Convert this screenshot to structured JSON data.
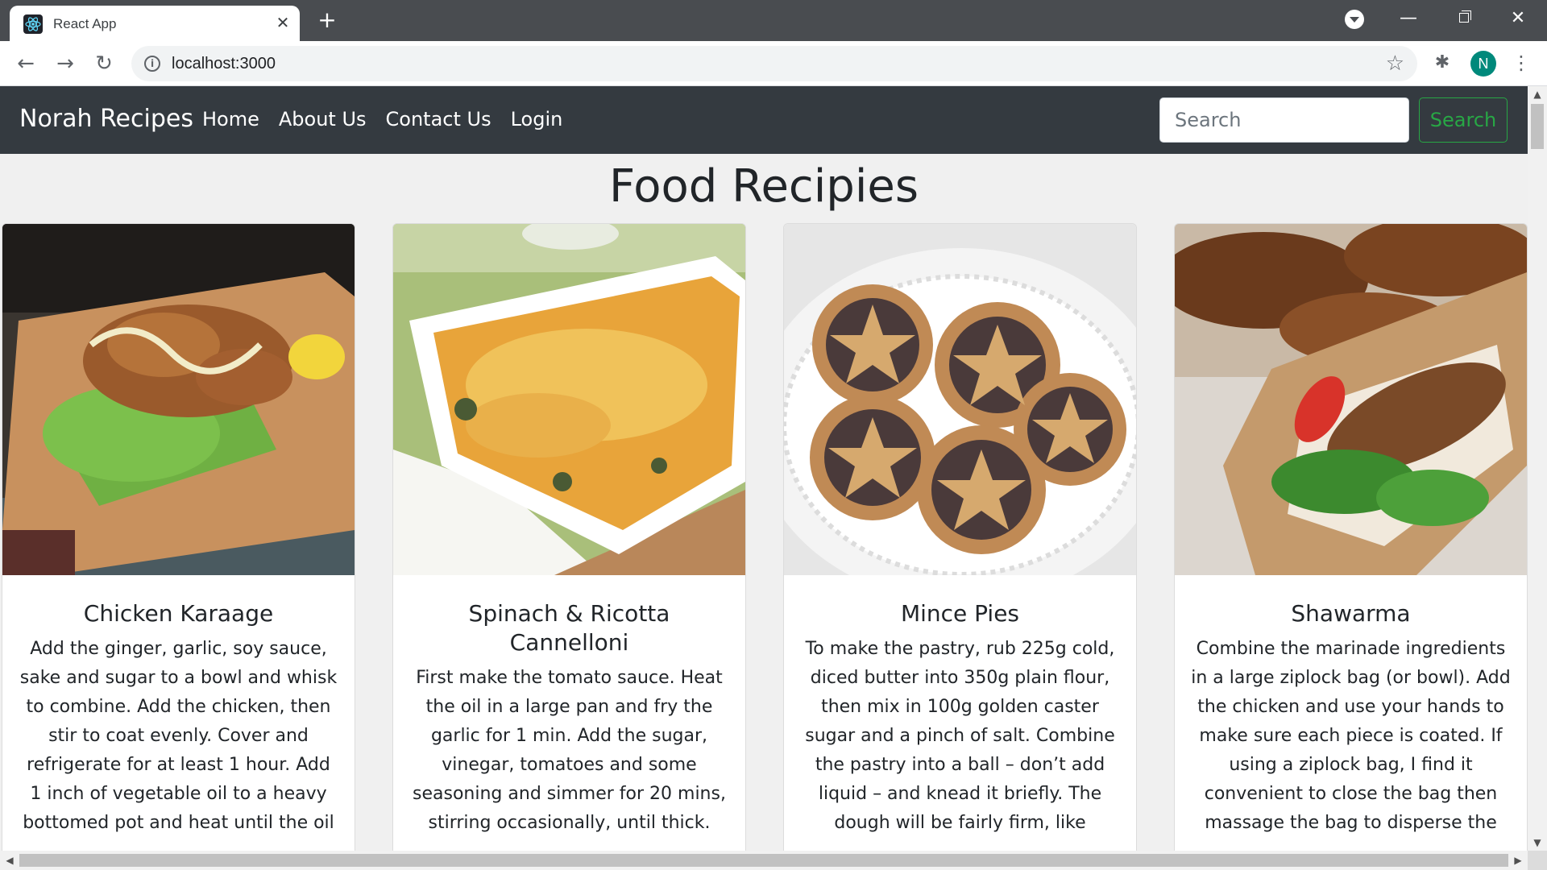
{
  "browser": {
    "tab_title": "React App",
    "tab_close": "✕",
    "new_tab": "+",
    "url": "localhost:3000",
    "back": "←",
    "forward": "→",
    "reload": "↻",
    "info": "i",
    "star": "☆",
    "extensions": "✱",
    "profile_initial": "N",
    "menu": "⋮",
    "minimize": "—",
    "close": "✕"
  },
  "navbar": {
    "brand": "Norah Recipes",
    "links": [
      "Home",
      "About Us",
      "Contact Us",
      "Login"
    ],
    "search_placeholder": "Search",
    "search_button": "Search"
  },
  "page_title": "Food Recipies",
  "recipes": [
    {
      "title": "Chicken Karaage",
      "text": "Add the ginger, garlic, soy sauce, sake and sugar to a bowl and whisk to combine. Add the chicken, then stir to coat evenly. Cover and refrigerate for at least 1 hour. Add 1 inch of vegetable oil to a heavy bottomed pot and heat until the oil"
    },
    {
      "title": "Spinach & Ricotta Cannelloni",
      "text": "First make the tomato sauce. Heat the oil in a large pan and fry the garlic for 1 min. Add the sugar, vinegar, tomatoes and some seasoning and simmer for 20 mins, stirring occasionally, until thick."
    },
    {
      "title": "Mince Pies",
      "text": "To make the pastry, rub 225g cold, diced butter into 350g plain flour, then mix in 100g golden caster sugar and a pinch of salt. Combine the pastry into a ball – don’t add liquid – and knead it briefly. The dough will be fairly firm, like"
    },
    {
      "title": "Shawarma",
      "text": "Combine the marinade ingredients in a large ziplock bag (or bowl). Add the chicken and use your hands to make sure each piece is coated. If using a ziplock bag, I find it convenient to close the bag then massage the bag to disperse the"
    }
  ],
  "colors": {
    "navbar_bg": "#343a40",
    "search_button": "#28a745",
    "tabbar_bg": "#494c50",
    "avatar_bg": "#00897b"
  }
}
